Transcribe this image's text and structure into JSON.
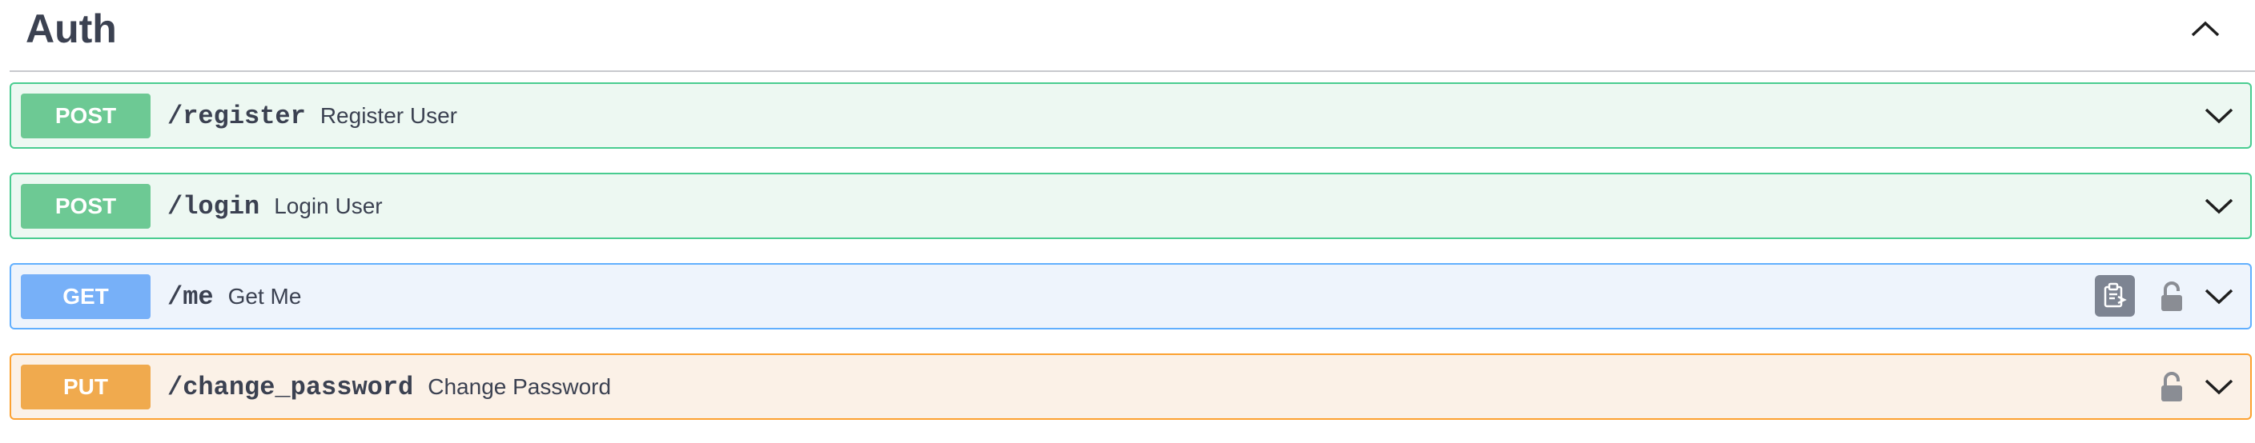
{
  "section": {
    "title": "Auth"
  },
  "operations": [
    {
      "method": "POST",
      "path": "/register",
      "summary": "Register User",
      "color": "#49cc90"
    },
    {
      "method": "POST",
      "path": "/login",
      "summary": "Login User",
      "color": "#49cc90"
    },
    {
      "method": "GET",
      "path": "/me",
      "summary": "Get Me",
      "color": "#61affe"
    },
    {
      "method": "PUT",
      "path": "/change_password",
      "summary": "Change Password",
      "color": "#fca130"
    }
  ],
  "icons": {
    "collapse": "chevron-up-icon",
    "expand": "chevron-down-icon",
    "lock": "unlocked-padlock-icon",
    "copy": "clipboard-copy-icon"
  }
}
